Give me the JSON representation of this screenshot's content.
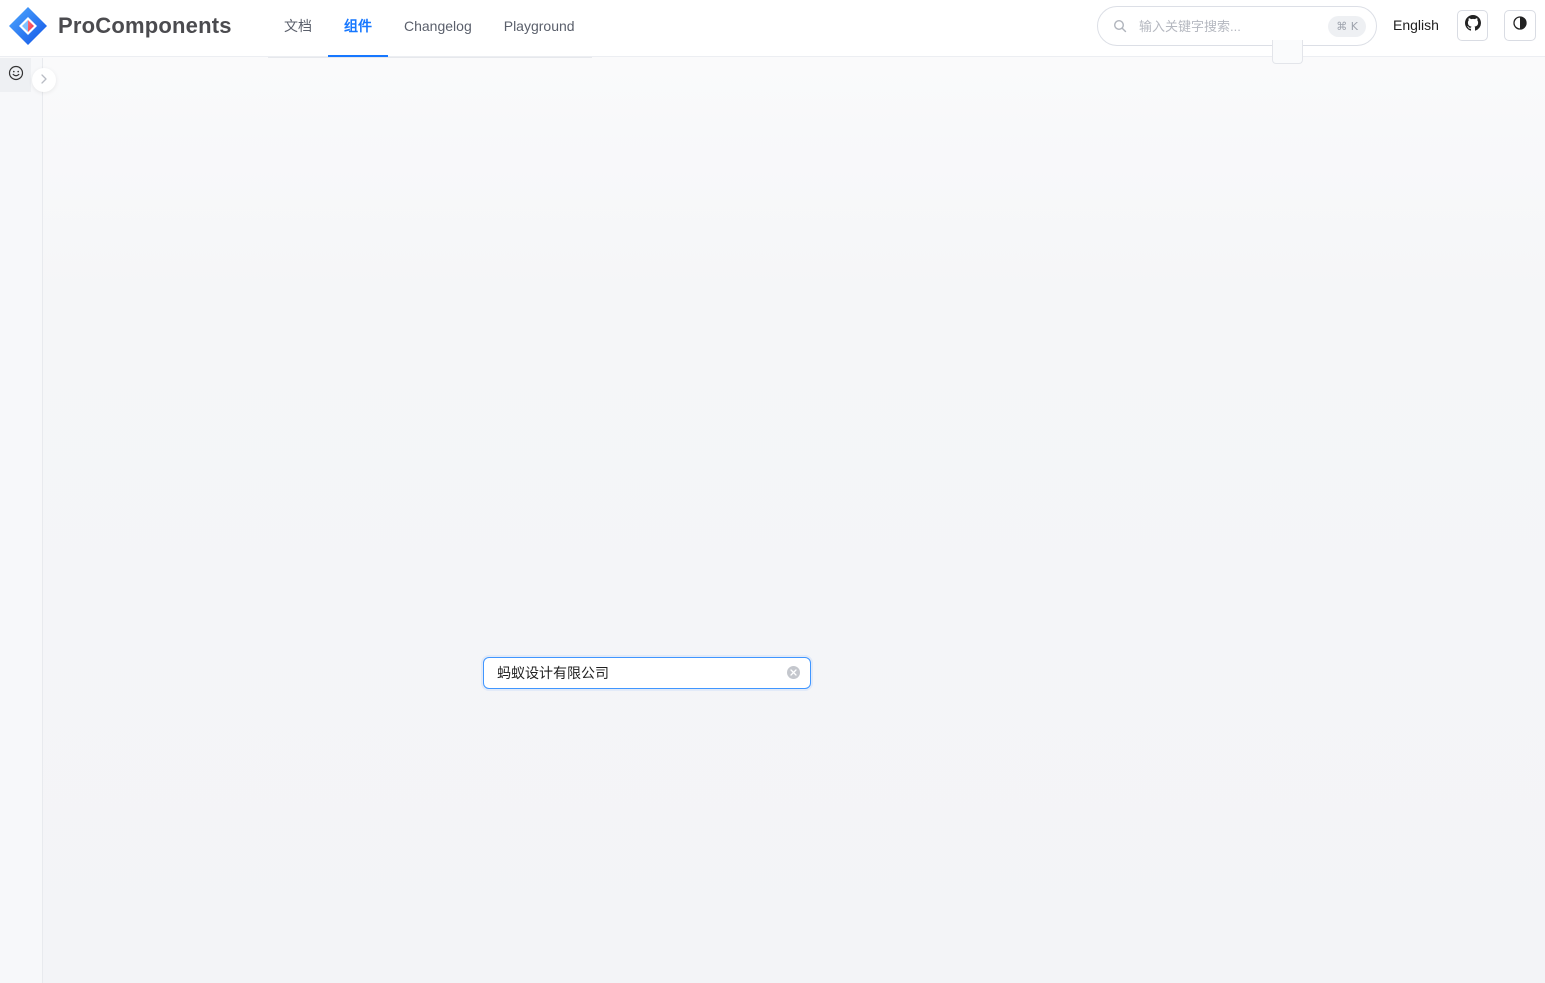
{
  "brand": {
    "name": "ProComponents",
    "accent_color": "#1677ff"
  },
  "nav": {
    "items": [
      {
        "label": "文档"
      },
      {
        "label": "组件"
      },
      {
        "label": "Changelog"
      },
      {
        "label": "Playground"
      }
    ],
    "active_index": 1
  },
  "search": {
    "placeholder": "输入关键字搜索...",
    "shortcut": "⌘ K"
  },
  "header": {
    "language_label": "English"
  },
  "icons": {
    "search": "search-icon",
    "github": "github-icon",
    "theme": "theme-toggle-icon",
    "smile": "smile-icon",
    "expand": "chevron-right-icon",
    "clear": "clear-circle-icon"
  },
  "form": {
    "company_value": "蚂蚁设计有限公司"
  }
}
